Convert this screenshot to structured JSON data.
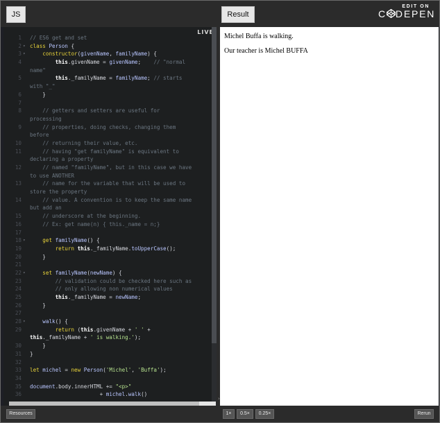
{
  "topbar": {
    "js_tab": "JS",
    "result_tab": "Result",
    "edit_on": "EDIT ON",
    "brand_left": "C",
    "brand_right": "DEPEN"
  },
  "code": {
    "live_badge": "LIVE",
    "lines": [
      {
        "n": "1",
        "g": "",
        "html": "<span class='cmt'>// ES6 get and set</span>"
      },
      {
        "n": "2",
        "g": "▾",
        "html": "<span class='kw'>class</span> <span class='fn'>Person</span> <span class='plain'>{</span>"
      },
      {
        "n": "3",
        "g": "▾",
        "html": "    <span class='kw'>constructor</span><span class='plain'>(</span><span class='pr'>givenName</span><span class='plain'>, </span><span class='pr'>familyName</span><span class='plain'>) {</span>"
      },
      {
        "n": "4",
        "g": "",
        "html": "        <span class='th'>this</span><span class='plain'>.givenName = </span><span class='pr'>givenName</span><span class='plain'>;    </span><span class='cmt'>// \"normal</span>"
      },
      {
        "n": "",
        "g": "",
        "html": "<span class='cmt'>name\"</span>"
      },
      {
        "n": "5",
        "g": "",
        "html": "        <span class='th'>this</span><span class='plain'>._familyName = </span><span class='pr'>familyName</span><span class='plain'>; </span><span class='cmt'>// starts</span>"
      },
      {
        "n": "",
        "g": "",
        "html": "<span class='cmt'>with \"_\"</span>"
      },
      {
        "n": "6",
        "g": "",
        "html": "    <span class='plain'>}</span>"
      },
      {
        "n": "7",
        "g": "",
        "html": ""
      },
      {
        "n": "8",
        "g": "",
        "html": "    <span class='cmt'>// getters and setters are useful for</span>"
      },
      {
        "n": "",
        "g": "",
        "html": "<span class='cmt'>processing</span>"
      },
      {
        "n": "9",
        "g": "",
        "html": "    <span class='cmt'>// properties, doing checks, changing them</span>"
      },
      {
        "n": "",
        "g": "",
        "html": "<span class='cmt'>before</span>"
      },
      {
        "n": "10",
        "g": "",
        "html": "    <span class='cmt'>// returning their value, etc.</span>"
      },
      {
        "n": "11",
        "g": "",
        "html": "    <span class='cmt'>// having \"get familyName\" is equivalent to</span>"
      },
      {
        "n": "",
        "g": "",
        "html": "<span class='cmt'>declaring a property</span>"
      },
      {
        "n": "12",
        "g": "",
        "html": "    <span class='cmt'>// named \"familyName\", but in this case we have</span>"
      },
      {
        "n": "",
        "g": "",
        "html": "<span class='cmt'>to use ANOTHER</span>"
      },
      {
        "n": "13",
        "g": "",
        "html": "    <span class='cmt'>// name for the variable that will be used to</span>"
      },
      {
        "n": "",
        "g": "",
        "html": "<span class='cmt'>store the property</span>"
      },
      {
        "n": "14",
        "g": "",
        "html": "    <span class='cmt'>// value. A convention is to keep the same name</span>"
      },
      {
        "n": "",
        "g": "",
        "html": "<span class='cmt'>but add an</span>"
      },
      {
        "n": "15",
        "g": "",
        "html": "    <span class='cmt'>// underscore at the beginning.</span>"
      },
      {
        "n": "16",
        "g": "",
        "html": "    <span class='cmt'>// Ex: get name(n) { this._name = n;}</span>"
      },
      {
        "n": "17",
        "g": "",
        "html": ""
      },
      {
        "n": "18",
        "g": "▾",
        "html": "    <span class='kw'>get</span> <span class='fn'>familyName</span><span class='plain'>() {</span>"
      },
      {
        "n": "19",
        "g": "",
        "html": "        <span class='kw'>return</span> <span class='th'>this</span><span class='plain'>._familyName.</span><span class='fn'>toUpperCase</span><span class='plain'>();</span>"
      },
      {
        "n": "20",
        "g": "",
        "html": "    <span class='plain'>}</span>"
      },
      {
        "n": "21",
        "g": "",
        "html": ""
      },
      {
        "n": "22",
        "g": "▾",
        "html": "    <span class='kw'>set</span> <span class='fn'>familyName</span><span class='plain'>(</span><span class='pr'>newName</span><span class='plain'>) {</span>"
      },
      {
        "n": "23",
        "g": "",
        "html": "        <span class='cmt'>// validation could be checked here such as</span>"
      },
      {
        "n": "24",
        "g": "",
        "html": "        <span class='cmt'>// only allowing non numerical values</span>"
      },
      {
        "n": "25",
        "g": "",
        "html": "        <span class='th'>this</span><span class='plain'>._familyName = </span><span class='pr'>newName</span><span class='plain'>;</span>"
      },
      {
        "n": "26",
        "g": "",
        "html": "    <span class='plain'>}</span>"
      },
      {
        "n": "27",
        "g": "",
        "html": ""
      },
      {
        "n": "28",
        "g": "▾",
        "html": "    <span class='fn'>walk</span><span class='plain'>() {</span>"
      },
      {
        "n": "29",
        "g": "",
        "html": "        <span class='kw'>return</span> <span class='plain'>(</span><span class='th'>this</span><span class='plain'>.givenName + </span><span class='str'>' '</span><span class='plain'> +</span>"
      },
      {
        "n": "",
        "g": "",
        "html": "<span class='th'>this</span><span class='plain'>._familyName + </span><span class='str'>' is walking.'</span><span class='plain'>);</span>"
      },
      {
        "n": "30",
        "g": "",
        "html": "    <span class='plain'>}</span>"
      },
      {
        "n": "31",
        "g": "",
        "html": "<span class='plain'>}</span>"
      },
      {
        "n": "32",
        "g": "",
        "html": ""
      },
      {
        "n": "33",
        "g": "",
        "html": "<span class='kw'>let</span> <span class='pr'>michel</span> <span class='plain'>= </span><span class='kw'>new</span> <span class='fn'>Person</span><span class='plain'>(</span><span class='str'>'Michel'</span><span class='plain'>, </span><span class='str'>'Buffa'</span><span class='plain'>);</span>"
      },
      {
        "n": "34",
        "g": "",
        "html": ""
      },
      {
        "n": "35",
        "g": "",
        "html": "<span class='pr'>document</span><span class='plain'>.body.innerHTML += </span><span class='str'>\"&lt;p&gt;\"</span>"
      },
      {
        "n": "36",
        "g": "",
        "html": "                      <span class='plain'>+ </span><span class='pr'>michel</span><span class='plain'>.</span><span class='fn'>walk</span><span class='plain'>()</span>"
      }
    ]
  },
  "result": {
    "line1": "Michel Buffa is walking.",
    "line2": "Our teacher is Michel BUFFA"
  },
  "bottombar": {
    "resources": "Resources",
    "zoom_1x": "1×",
    "zoom_05x": "0.5×",
    "zoom_025x": "0.25×",
    "rerun": "Rerun"
  }
}
